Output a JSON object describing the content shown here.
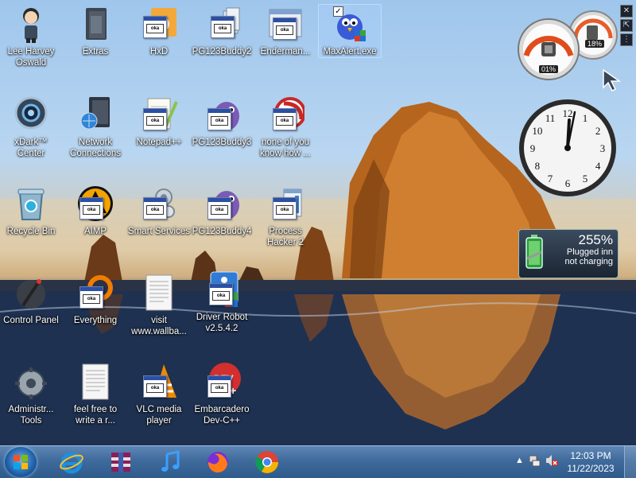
{
  "desktop": {
    "icons": [
      {
        "label": "Lee Harvey Oswald"
      },
      {
        "label": "Extras"
      },
      {
        "label": "HxD"
      },
      {
        "label": "PG123Buddy2"
      },
      {
        "label": "Enderman..."
      },
      {
        "label": "MaxAlert.exe"
      },
      {
        "label": "xDark™ Center"
      },
      {
        "label": "Network Connections"
      },
      {
        "label": "Notepad++"
      },
      {
        "label": "PG123Buddy3"
      },
      {
        "label": "none of you know how ..."
      },
      {
        "label": "Recycle Bin"
      },
      {
        "label": "AIMP"
      },
      {
        "label": "Smart Services"
      },
      {
        "label": "PG123Buddy4"
      },
      {
        "label": "Process Hacker 2"
      },
      {
        "label": "Control Panel"
      },
      {
        "label": "Everything"
      },
      {
        "label": "visit www.wallba..."
      },
      {
        "label": "Driver Robot v2.5.4.2"
      },
      {
        "label": "Administr... Tools"
      },
      {
        "label": "feel free to write a r..."
      },
      {
        "label": "VLC media player"
      },
      {
        "label": "Embarcadero Dev-C++"
      }
    ],
    "glyph_text": "oka",
    "selected_check": "✓"
  },
  "gadgets": {
    "cpu_left": "01%",
    "cpu_right": "18%",
    "battery": {
      "percent": "255%",
      "line1": "Plugged inn",
      "line2": "not charging"
    },
    "clock": {
      "numerals": [
        "12",
        "1",
        "2",
        "3",
        "4",
        "5",
        "6",
        "7",
        "8",
        "9",
        "10",
        "11"
      ]
    },
    "sidebar_buttons": [
      "✕",
      "⇱",
      "⋮"
    ]
  },
  "taskbar": {
    "pinned": [
      "internet-explorer",
      "winrar",
      "itunes",
      "firefox",
      "chrome"
    ],
    "tray": {
      "time": "12:03 PM",
      "date": "11/22/2023",
      "show_hidden": "▲"
    }
  },
  "colors": {
    "taskbar": "#3f6a9c",
    "selection": "#aad2ff"
  }
}
